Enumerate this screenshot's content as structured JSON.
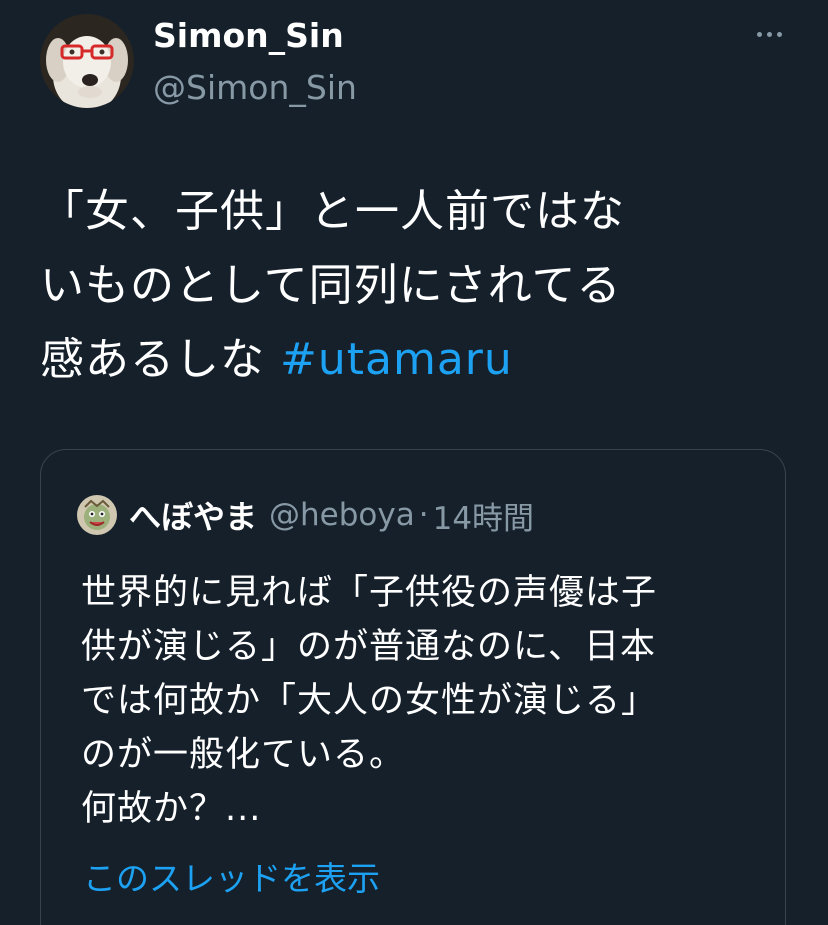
{
  "tweet": {
    "display_name": "Simon_Sin",
    "handle": "@Simon_Sin",
    "text_lines": [
      "「女、子供」と一人前ではな",
      "いものとして同列にされてる",
      "感あるしな "
    ],
    "hashtag": "#utamaru"
  },
  "quote": {
    "display_name": "へぼやま",
    "handle": "@heboya",
    "separator": "·",
    "time": "14時間",
    "text_lines": [
      "世界的に見れば「子供役の声優は子",
      "供が演じる」のが普通なのに、日本",
      "では何故か「大人の女性が演じる」",
      "のが一般化ている。",
      "何故か？..."
    ],
    "show_thread": "このスレッドを表示"
  },
  "icons": {
    "more": "more-horizontal-icon",
    "avatar": "dog-with-red-glasses",
    "quote_avatar": "cartoon-character"
  },
  "colors": {
    "background": "#15202b",
    "text": "#ffffff",
    "secondary": "#8899a6",
    "link": "#1da1f2",
    "border": "#38444d"
  }
}
